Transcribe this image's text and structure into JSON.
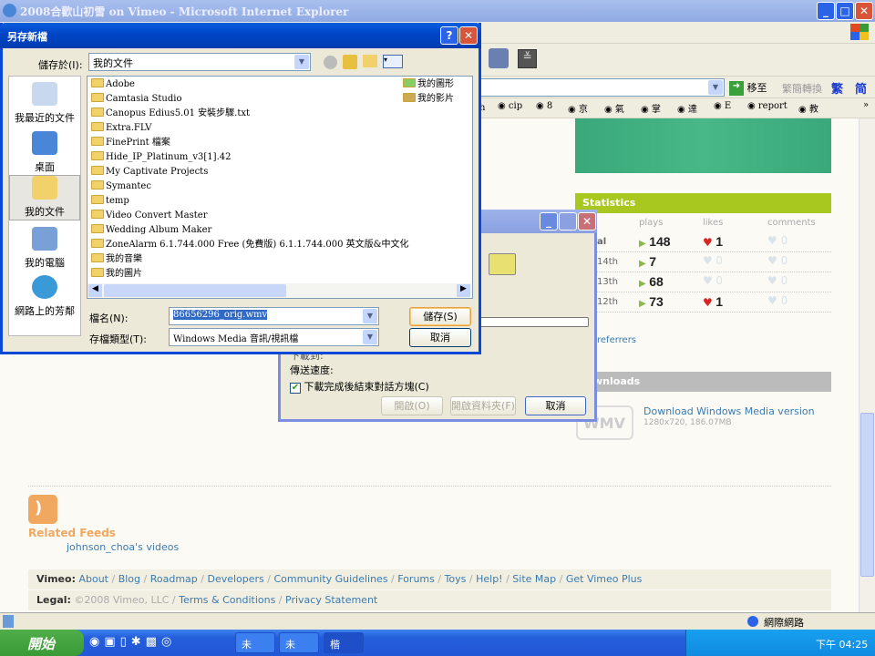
{
  "window": {
    "title": "2008合歡山初雪 on Vimeo - Microsoft Internet Explorer",
    "min": "_",
    "max": "□",
    "close": "✕"
  },
  "address": {
    "go_label": "移至",
    "convert_label": "繁簡轉換",
    "trad": "繁",
    "simp": "简"
  },
  "links_bar": {
    "items": [
      "h",
      "cip",
      "8",
      "京",
      "氣",
      "掌",
      "達",
      "E",
      "report",
      "教"
    ],
    "more": "»"
  },
  "stats": {
    "title": "Statistics",
    "headers": [
      "plays",
      "likes",
      "comments"
    ],
    "rows": [
      {
        "label": "al",
        "plays": "148",
        "likes": "1",
        "comments": "0",
        "liked": true
      },
      {
        "label": "14th",
        "plays": "7",
        "likes": "0",
        "comments": "0",
        "liked": false
      },
      {
        "label": "13th",
        "plays": "68",
        "likes": "0",
        "comments": "0",
        "liked": false
      },
      {
        "label": "12th",
        "plays": "73",
        "likes": "1",
        "comments": "0",
        "liked": true
      }
    ],
    "referrers": "referrers"
  },
  "downloads": {
    "title": "wnloads",
    "badge": "WMV",
    "link": "Download Windows Media version",
    "meta": "1280x720, 186.07MB"
  },
  "feeds": {
    "title": "Related Feeds",
    "link": "johnson_choa's videos"
  },
  "footer": {
    "vimeo_label": "Vimeo:",
    "vimeo_links": [
      "About",
      "Blog",
      "Roadmap",
      "Developers",
      "Community Guidelines",
      "Forums",
      "Toys",
      "Help!",
      "Site Map",
      "Get Vimeo Plus"
    ],
    "legal_label": "Legal:",
    "copyright": "©2008 Vimeo, LLC",
    "legal_links": [
      "Terms & Conditions",
      "Privacy Statement"
    ]
  },
  "statusbar": {
    "zone": "網際網路"
  },
  "taskbar": {
    "start": "開始",
    "tasks": [
      "未",
      "未",
      "楷"
    ],
    "clock": "下午 04:25"
  },
  "save_dialog": {
    "title": "另存新檔",
    "help": "?",
    "close": "✕",
    "save_in_label": "儲存於(I):",
    "save_in_value": "我的文件",
    "places": [
      "我最近的文件",
      "桌面",
      "我的文件",
      "我的電腦",
      "網路上的芳鄰"
    ],
    "files": [
      "Adobe",
      "Camtasia Studio",
      "Canopus Edius5.01 安裝步驟.txt",
      "Extra.FLV",
      "FinePrint 檔案",
      "Hide_IP_Platinum_v3[1].42",
      "My Captivate Projects",
      "Symantec",
      "temp",
      "Video Convert Master",
      "Wedding Album Maker",
      "ZoneAlarm 6.1.744.000 Free (免費版) 6.1.1.744.000  英文版&中文化",
      "我的音樂",
      "我的圖片"
    ],
    "files_col2": [
      "我的圖形",
      "我的影片"
    ],
    "filename_label": "檔名(N):",
    "filename_value": "86656296_orig.wmv",
    "filetype_label": "存檔類型(T):",
    "filetype_value": "Windows Media 音訊/視訊檔",
    "save_button": "儲存(S)",
    "cancel_button": "取消"
  },
  "download_dialog": {
    "speed_label": "傳送速度:",
    "partial_label": "下載到:",
    "close_when_done": "下載完成後結束對話方塊(C)",
    "close_checked": true,
    "open_button": "開啟(O)",
    "open_folder_button": "開啟資料夾(F)",
    "cancel_button": "取消"
  },
  "colors": {
    "stats_green": "#a8c820",
    "downloads_gray": "#bbbbbb",
    "link_blue": "#3a7ab0",
    "feed_orange": "#f0a860"
  }
}
